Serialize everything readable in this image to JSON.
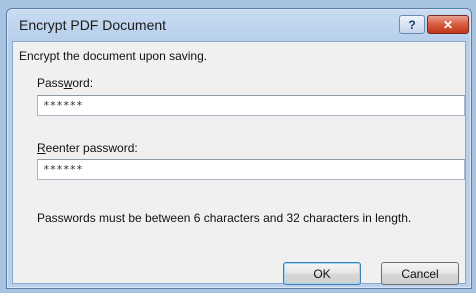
{
  "window": {
    "title": "Encrypt PDF Document",
    "help_glyph": "?",
    "close_glyph": "✕"
  },
  "dialog": {
    "intro": "Encrypt the document upon saving.",
    "password_label_pre": "Pass",
    "password_label_key": "w",
    "password_label_post": "ord:",
    "password_value": "******",
    "reenter_label_key": "R",
    "reenter_label_rest": "eenter password:",
    "reenter_value": "******",
    "note": "Passwords must be between 6 characters and 32 characters in length."
  },
  "buttons": {
    "ok": "OK",
    "cancel": "Cancel"
  },
  "colors": {
    "close_button": "#c0381c",
    "default_button_border": "#3c7fb1"
  }
}
